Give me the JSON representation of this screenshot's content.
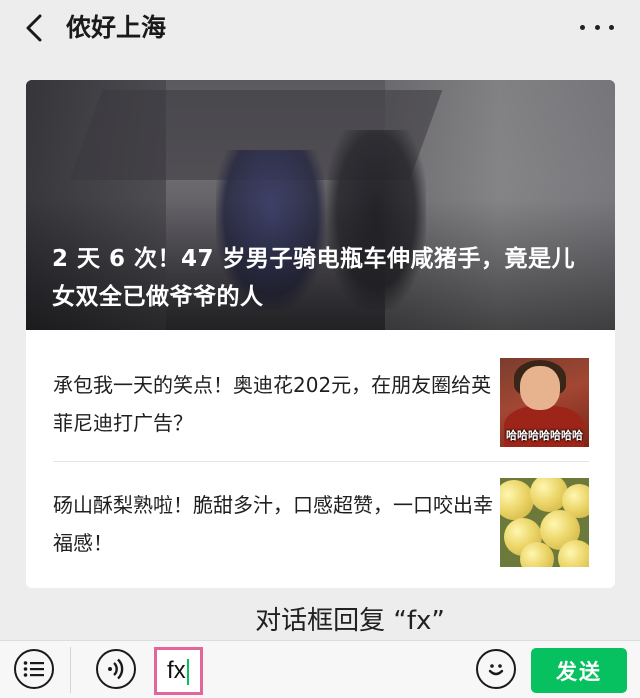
{
  "header": {
    "title": "侬好上海",
    "back_icon": "chevron-left-icon",
    "more_icon": "more-dots-icon"
  },
  "article_card": {
    "hero": {
      "title": "2 天 6 次！47 岁男子骑电瓶车伸咸猪手，竟是儿女双全已做爷爷的人"
    },
    "items": [
      {
        "title": "承包我一天的笑点！奥迪花202元，在朋友圈给英菲尼迪打广告？",
        "thumbnail_caption": "哈哈哈哈哈哈哈"
      },
      {
        "title": "砀山酥梨熟啦！脆甜多汁，口感超赞，一口咬出幸福感！"
      }
    ]
  },
  "reply_hint": "对话框回复 “fx”",
  "input_bar": {
    "input_value": "fx",
    "send_label": "发送",
    "menu_icon": "menu-list-icon",
    "voice_icon": "voice-icon",
    "emoji_icon": "emoji-icon"
  },
  "colors": {
    "accent": "#07c160",
    "highlight_border": "#e4659a",
    "background": "#ededed"
  }
}
